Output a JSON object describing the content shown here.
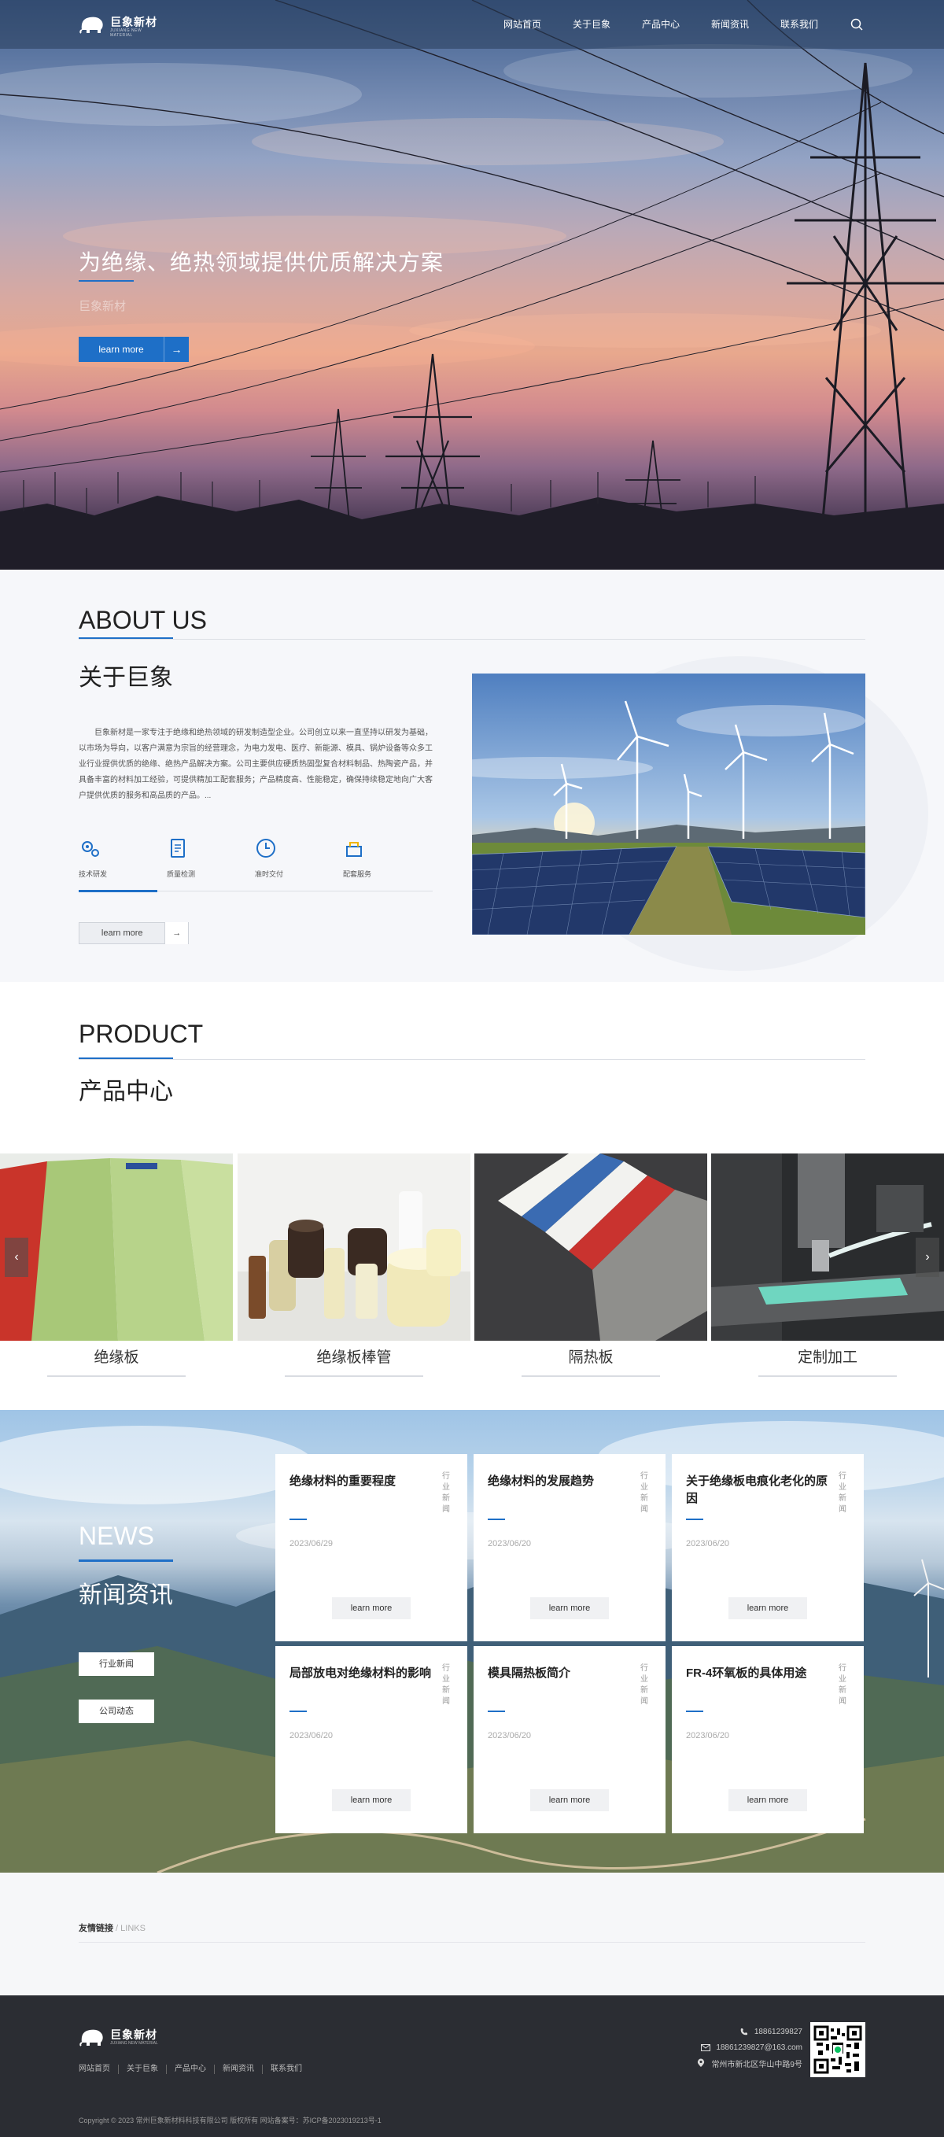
{
  "header": {
    "logo_name": "巨象新材",
    "logo_sub": "JUXIANG NEW MATERIAL",
    "nav": [
      "网站首页",
      "关于巨象",
      "产品中心",
      "新闻资讯",
      "联系我们"
    ]
  },
  "hero": {
    "title": "为绝缘、绝热领域提供优质解决方案",
    "subtitle": "巨象新材",
    "button_label": "learn more",
    "arrow": "→"
  },
  "about": {
    "title_en": "ABOUT US",
    "title_cn": "关于巨象",
    "text": "巨象新材是一家专注于绝缘和绝热领域的研发制造型企业。公司创立以来一直坚持以研发为基础，以市场为导向，以客户满意为宗旨的经营理念，为电力发电、医疗、新能源、模具、锅炉设备等众多工业行业提供优质的绝缘、绝热产品解决方案。公司主要供应硬质热固型复合材料制品、热陶瓷产品，并具备丰富的材料加工经验，可提供精加工配套服务；产品精度高、性能稳定，确保持续稳定地向广大客户提供优质的服务和高品质的产品。...",
    "features": [
      "技术研发",
      "质量检测",
      "准时交付",
      "配套服务"
    ],
    "more_label": "learn more",
    "arrow": "→"
  },
  "product": {
    "title_en": "PRODUCT",
    "title_cn": "产品中心",
    "items": [
      "绝缘板",
      "绝缘板棒管",
      "隔热板",
      "定制加工"
    ],
    "prev": "‹",
    "next": "›"
  },
  "news": {
    "title_en": "NEWS",
    "title_cn": "新闻资讯",
    "tabs": [
      "行业新闻",
      "公司动态"
    ],
    "items": [
      {
        "title": "绝缘材料的重要程度",
        "category": "行业新闻",
        "date": "2023/06/29",
        "button": "learn more"
      },
      {
        "title": "绝缘材料的发展趋势",
        "category": "行业新闻",
        "date": "2023/06/20",
        "button": "learn more"
      },
      {
        "title": "关于绝缘板电痕化老化的原因",
        "category": "行业新闻",
        "date": "2023/06/20",
        "button": "learn more"
      },
      {
        "title": "局部放电对绝缘材料的影响",
        "category": "行业新闻",
        "date": "2023/06/20",
        "button": "learn more"
      },
      {
        "title": "模具隔热板简介",
        "category": "行业新闻",
        "date": "2023/06/20",
        "button": "learn more"
      },
      {
        "title": "FR-4环氧板的具体用途",
        "category": "行业新闻",
        "date": "2023/06/20",
        "button": "learn more"
      }
    ]
  },
  "links": {
    "title": "友情链接",
    "sub": " / LINKS"
  },
  "footer": {
    "logo_name": "巨象新材",
    "logo_sub": "JUXIANG NEW MATERIAL",
    "nav": [
      "网站首页",
      "关于巨象",
      "产品中心",
      "新闻资讯",
      "联系我们"
    ],
    "phone": "18861239827",
    "email": "18861239827@163.com",
    "address": "常州市新北区华山中路9号",
    "copyright": "Copyright © 2023 常州巨象新材料科技有限公司 版权所有 网站备案号：苏ICP备2023019213号-1"
  },
  "colors": {
    "accent": "#1e6fc7",
    "footer_bg": "#2b2d33",
    "section_bg": "#f6f7fa"
  },
  "icons": [
    "elephant-logo",
    "search-icon",
    "arrow-right-icon",
    "gear-icon",
    "document-icon",
    "clock-icon",
    "service-icon",
    "phone-icon",
    "mail-icon",
    "location-icon",
    "qr-code"
  ]
}
